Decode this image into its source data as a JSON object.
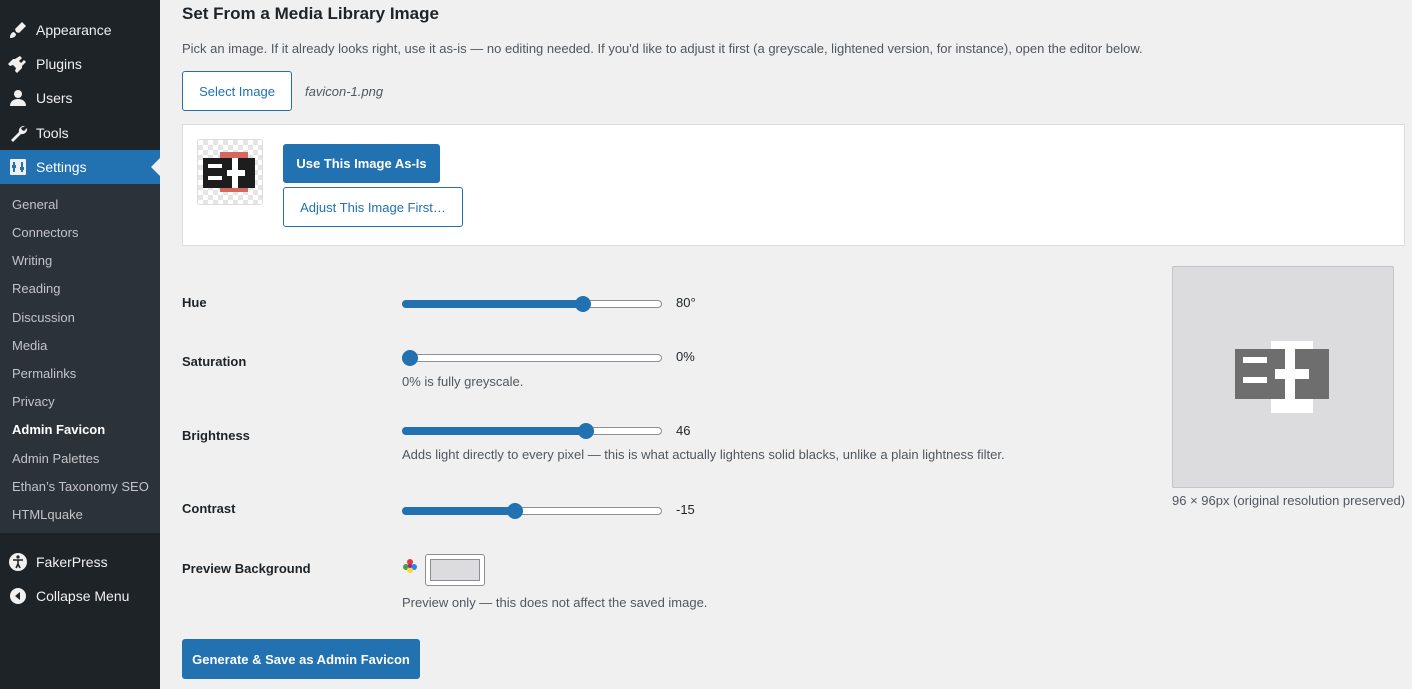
{
  "sidebar": {
    "top_items": [
      {
        "label": "Appearance",
        "icon": "paintbrush-icon"
      },
      {
        "label": "Plugins",
        "icon": "plugin-icon"
      },
      {
        "label": "Users",
        "icon": "users-icon"
      },
      {
        "label": "Tools",
        "icon": "wrench-icon"
      },
      {
        "label": "Settings",
        "icon": "settings-icon",
        "current": true
      }
    ],
    "submenu": [
      {
        "label": "General"
      },
      {
        "label": "Connectors"
      },
      {
        "label": "Writing"
      },
      {
        "label": "Reading"
      },
      {
        "label": "Discussion"
      },
      {
        "label": "Media"
      },
      {
        "label": "Permalinks"
      },
      {
        "label": "Privacy"
      },
      {
        "label": "Admin Favicon",
        "current": true
      },
      {
        "label": "Admin Palettes"
      },
      {
        "label": "Ethan’s Taxonomy SEO"
      },
      {
        "label": "HTMLquake"
      }
    ],
    "bottom_items": [
      {
        "label": "FakerPress",
        "icon": "accessibility-icon"
      },
      {
        "label": "Collapse Menu",
        "icon": "collapse-icon"
      }
    ]
  },
  "section": {
    "title": "Set From a Media Library Image",
    "description": "Pick an image. If it already looks right, use it as-is — no editing needed. If you'd like to adjust it first (a greyscale, lightened version, for instance), open the editor below.",
    "select_button": "Select Image",
    "filename": "favicon-1.png",
    "use_button": "Use This Image As-Is",
    "adjust_button": "Adjust This Image First…"
  },
  "controls": {
    "hue": {
      "label": "Hue",
      "value_text": "80°",
      "fraction": 0.71
    },
    "saturation": {
      "label": "Saturation",
      "value_text": "0%",
      "fraction": 0.0,
      "help": "0% is fully greyscale."
    },
    "brightness": {
      "label": "Brightness",
      "value_text": "46",
      "fraction": 0.72,
      "help": "Adds light directly to every pixel — this is what actually lightens solid blacks, unlike a plain lightness filter."
    },
    "contrast": {
      "label": "Contrast",
      "value_text": "-15",
      "fraction": 0.43
    },
    "preview_background": {
      "label": "Preview Background",
      "color": "#dcdcde",
      "help": "Preview only — this does not affect the saved image."
    }
  },
  "preview": {
    "caption": "96 × 96px (original resolution preserved)"
  },
  "save_button": "Generate & Save as Admin Favicon",
  "colors": {
    "accent": "#2271b1",
    "sidebar": "#1d2327",
    "submenu": "#2c3338"
  }
}
